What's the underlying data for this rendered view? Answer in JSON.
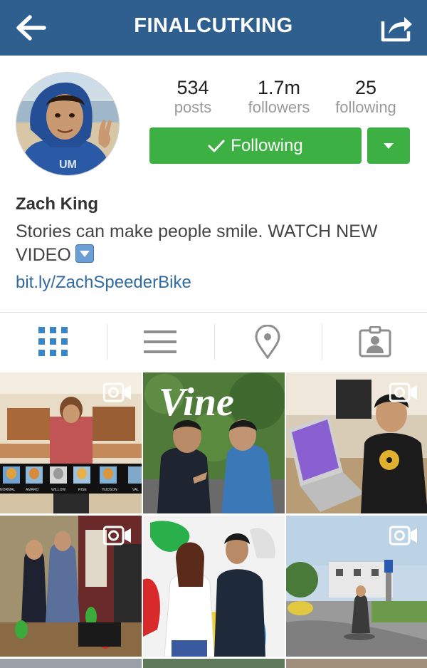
{
  "header": {
    "title": "FINALCUTKING",
    "back_icon": "arrow-left-icon",
    "share_icon": "share-icon"
  },
  "profile": {
    "stats": [
      {
        "value": "534",
        "label": "posts"
      },
      {
        "value": "1.7m",
        "label": "followers"
      },
      {
        "value": "25",
        "label": "following"
      }
    ],
    "follow_label": "Following",
    "name": "Zach King",
    "bio": "Stories can make people smile. WATCH NEW VIDEO",
    "link": "bit.ly/ZachSpeederBike"
  },
  "tabs": [
    {
      "icon": "grid-icon",
      "active": true
    },
    {
      "icon": "list-icon",
      "active": false
    },
    {
      "icon": "location-pin-icon",
      "active": false
    },
    {
      "icon": "tagged-photos-icon",
      "active": false
    }
  ],
  "grid": {
    "tile1_labels": [
      "NORMAL",
      "AMARO",
      "WILLOW",
      "RISE",
      "HUDSON",
      "VAL"
    ],
    "tile2_logo": "Vine"
  },
  "colors": {
    "header_bg": "#2f5f8f",
    "follow_green": "#3cb043",
    "link_blue": "#2f6aa3",
    "tab_active": "#3a85c6"
  }
}
